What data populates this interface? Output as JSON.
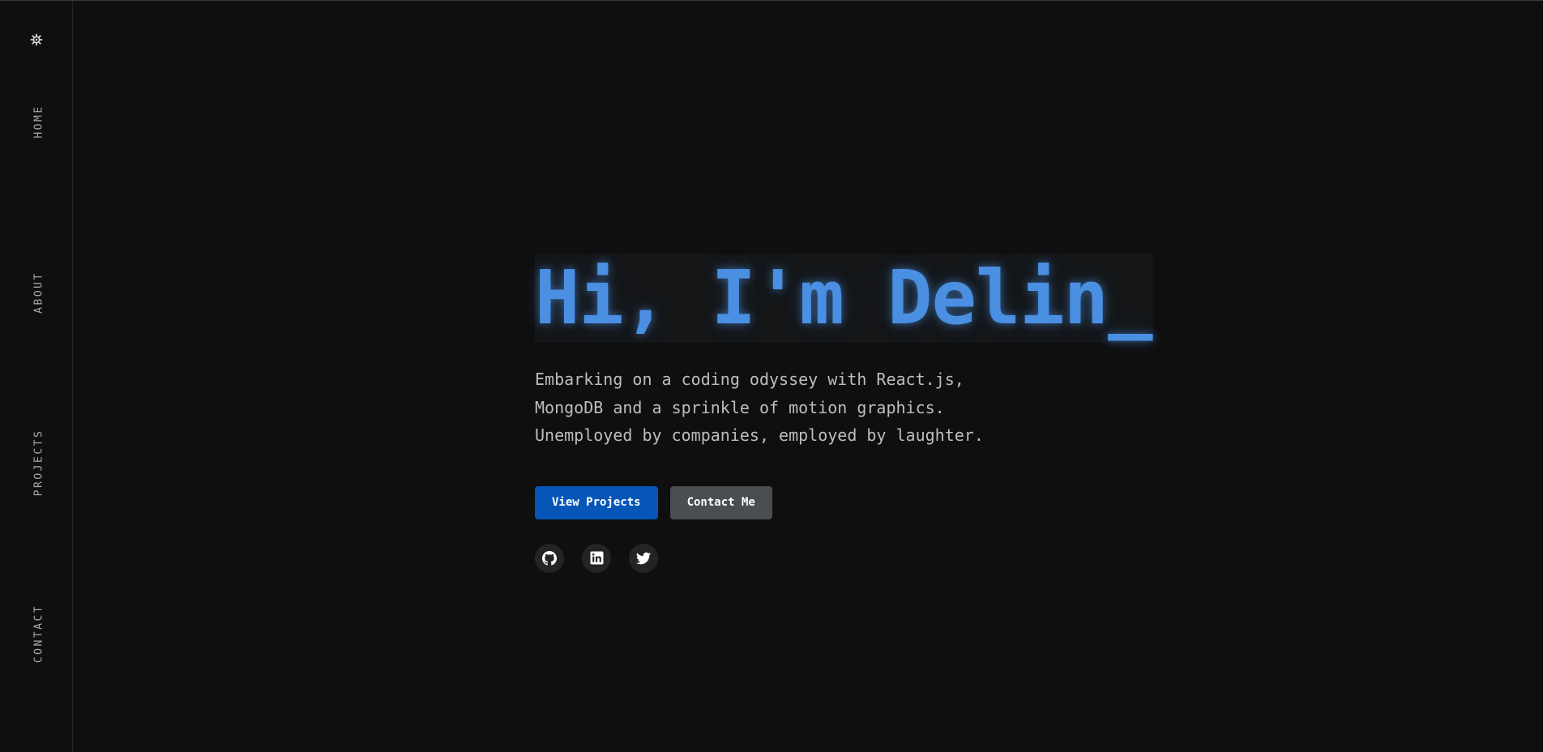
{
  "sidebar": {
    "theme_icon": "gear-icon",
    "nav": [
      {
        "label": "HOME"
      },
      {
        "label": "ABOUT"
      },
      {
        "label": "PROJECTS"
      },
      {
        "label": "CONTACT"
      }
    ]
  },
  "hero": {
    "headline": "Hi, I'm Delin",
    "cursor": "_",
    "tagline": "Embarking on a coding odyssey with React.js, MongoDB and a sprinkle of motion graphics. Unemployed by companies, employed by laughter.",
    "buttons": {
      "primary_label": "View Projects",
      "secondary_label": "Contact Me"
    },
    "socials": [
      {
        "icon": "github-icon"
      },
      {
        "icon": "linkedin-icon"
      },
      {
        "icon": "twitter-icon"
      }
    ]
  },
  "colors": {
    "background": "#0f0f0f",
    "accent": "#4a8fe2",
    "primary_button": "#0656b8",
    "secondary_button": "#4a4d52"
  }
}
